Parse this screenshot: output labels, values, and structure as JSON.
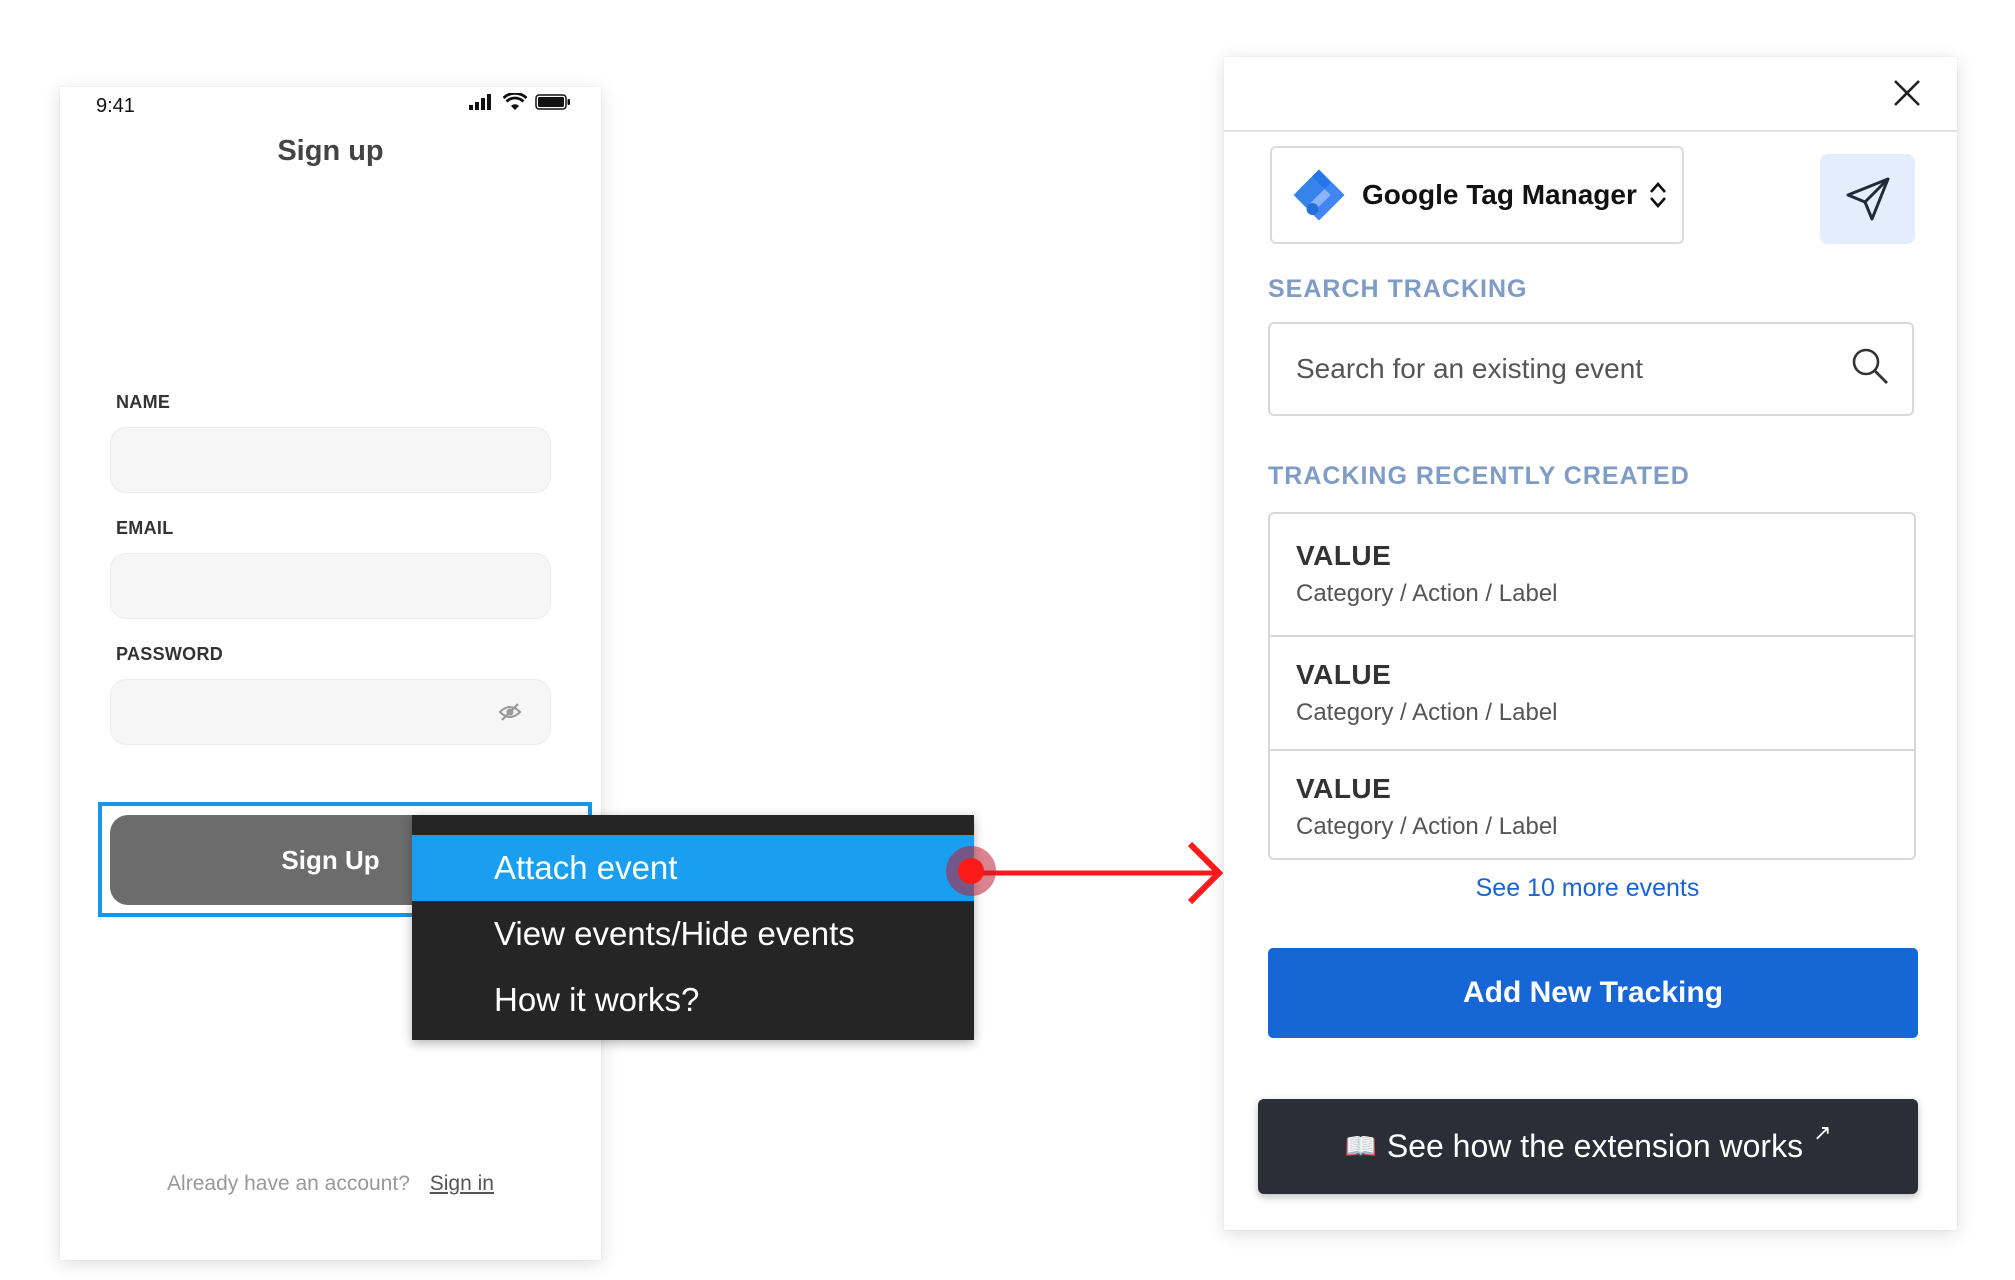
{
  "phone": {
    "time": "9:41",
    "title": "Sign up",
    "fields": [
      {
        "label": "NAME"
      },
      {
        "label": "EMAIL"
      },
      {
        "label": "PASSWORD"
      }
    ],
    "signup_button": "Sign Up",
    "footer_text": "Already have an account?",
    "footer_link": "Sign in"
  },
  "context_menu": {
    "items": [
      "Attach event",
      "View events/Hide events",
      "How it works?"
    ],
    "active_index": 0
  },
  "panel": {
    "platform": "Google Tag Manager",
    "search_label": "SEARCH TRACKING",
    "search_placeholder": "Search for an existing event",
    "recent_label": "TRACKING RECENTLY CREATED",
    "recent": [
      {
        "value": "VALUE",
        "path": "Category / Action / Label"
      },
      {
        "value": "VALUE",
        "path": "Category / Action / Label"
      },
      {
        "value": "VALUE",
        "path": "Category / Action / Label"
      }
    ],
    "more_link": "See 10 more events",
    "add_button": "Add New Tracking",
    "how_button": "See how the extension works"
  },
  "colors": {
    "accent_blue": "#1766d5",
    "menu_highlight": "#1a9ff0",
    "arrow_red": "#ff1a1a",
    "section_label": "#7e9cc6"
  },
  "icons": [
    "signal-icon",
    "wifi-icon",
    "battery-icon",
    "eye-slash-icon",
    "close-icon",
    "gtm-logo-icon",
    "chevron-updown-icon",
    "send-icon",
    "search-icon",
    "book-icon",
    "external-link-icon"
  ]
}
